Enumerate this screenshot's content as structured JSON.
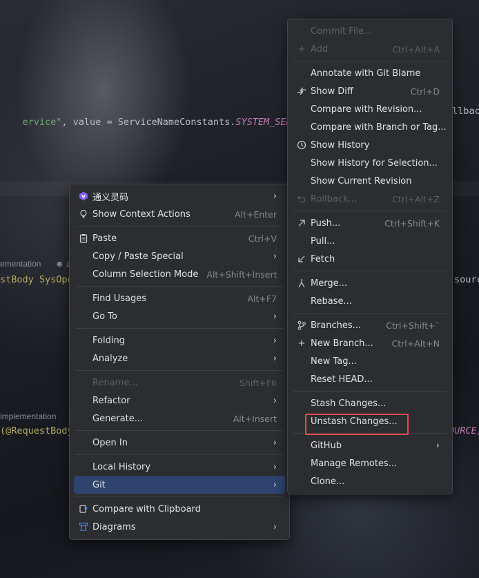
{
  "editor": {
    "line1_str": "ervice\"",
    "line1_mid": ", value = ServiceNameConstants.",
    "line1_const": "SYSTEM_SERVICE",
    "line1_comma": ",",
    "line1_tail": "llbac",
    "hint1": "ementation",
    "hint1_tail": "z",
    "line2_ann": "stBody SysOpe",
    "line2_tail": "source",
    "hint2": "implementation",
    "line3_ann": "(@RequestBody",
    "line3_tail": "OURCE)"
  },
  "context_menu": {
    "items": [
      {
        "label": "通义灵码",
        "icon": "tongyi-icon",
        "submenu": true
      },
      {
        "label": "Show Context Actions",
        "shortcut": "Alt+Enter",
        "icon": "lightbulb-icon"
      },
      {
        "label": "Paste",
        "shortcut": "Ctrl+V",
        "icon": "clipboard-icon"
      },
      {
        "label": "Copy / Paste Special",
        "submenu": true
      },
      {
        "label": "Column Selection Mode",
        "shortcut": "Alt+Shift+Insert"
      },
      {
        "label": "Find Usages",
        "shortcut": "Alt+F7"
      },
      {
        "label": "Go To",
        "submenu": true
      },
      {
        "label": "Folding",
        "submenu": true
      },
      {
        "label": "Analyze",
        "submenu": true
      },
      {
        "label": "Rename...",
        "shortcut": "Shift+F6",
        "disabled": true
      },
      {
        "label": "Refactor",
        "submenu": true
      },
      {
        "label": "Generate...",
        "shortcut": "Alt+Insert"
      },
      {
        "label": "Open In",
        "submenu": true
      },
      {
        "label": "Local History",
        "submenu": true
      },
      {
        "label": "Git",
        "submenu": true,
        "selected": true
      },
      {
        "label": "Compare with Clipboard",
        "icon": "compare-clipboard-icon"
      },
      {
        "label": "Diagrams",
        "icon": "diagram-icon",
        "submenu": true
      }
    ]
  },
  "git_menu": {
    "items": [
      {
        "label": "Commit File...",
        "disabled": true
      },
      {
        "label": "Add",
        "shortcut": "Ctrl+Alt+A",
        "icon": "plus-icon",
        "disabled": true
      },
      {
        "label": "Annotate with Git Blame"
      },
      {
        "label": "Show Diff",
        "shortcut": "Ctrl+D",
        "icon": "diff-icon"
      },
      {
        "label": "Compare with Revision..."
      },
      {
        "label": "Compare with Branch or Tag..."
      },
      {
        "label": "Show History",
        "icon": "history-icon"
      },
      {
        "label": "Show History for Selection..."
      },
      {
        "label": "Show Current Revision"
      },
      {
        "label": "Rollback...",
        "shortcut": "Ctrl+Alt+Z",
        "icon": "rollback-icon",
        "disabled": true
      },
      {
        "label": "Push...",
        "shortcut": "Ctrl+Shift+K",
        "icon": "push-icon"
      },
      {
        "label": "Pull..."
      },
      {
        "label": "Fetch",
        "icon": "fetch-icon"
      },
      {
        "label": "Merge...",
        "icon": "merge-icon"
      },
      {
        "label": "Rebase..."
      },
      {
        "label": "Branches...",
        "shortcut": "Ctrl+Shift+`",
        "icon": "branch-icon"
      },
      {
        "label": "New Branch...",
        "shortcut": "Ctrl+Alt+N",
        "icon": "plus-icon"
      },
      {
        "label": "New Tag..."
      },
      {
        "label": "Reset HEAD..."
      },
      {
        "label": "Stash Changes..."
      },
      {
        "label": "Unstash Changes...",
        "highlighted": true
      },
      {
        "label": "GitHub",
        "submenu": true
      },
      {
        "label": "Manage Remotes..."
      },
      {
        "label": "Clone..."
      }
    ]
  },
  "colors": {
    "menu_bg": "#2b2d30",
    "selection": "#2e436e",
    "highlight_box": "#e5494a"
  }
}
